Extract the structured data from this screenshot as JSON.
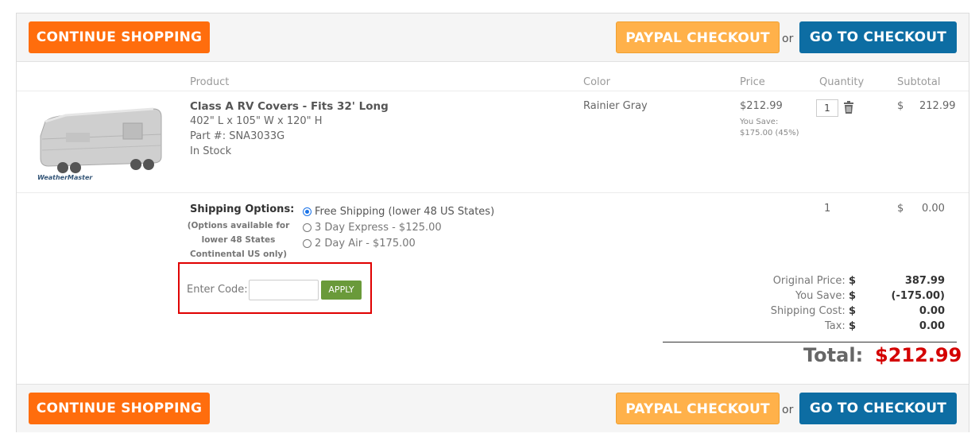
{
  "toolbar": {
    "continue_label": "CONTINUE SHOPPING",
    "paypal_label": "PAYPAL CHECKOUT",
    "or_label": "or",
    "checkout_label": "GO TO CHECKOUT"
  },
  "table": {
    "headers": {
      "product": "Product",
      "color": "Color",
      "price": "Price",
      "quantity": "Quantity",
      "subtotal": "Subtotal"
    }
  },
  "item": {
    "name": "Class A RV Covers - Fits 32' Long",
    "dimensions": "402\" L x 105\" W x 120\" H",
    "part": "Part #: SNA3033G",
    "stock": "In Stock",
    "color": "Rainier Gray",
    "price": "$212.99",
    "save_line1": "You Save:",
    "save_line2": "$175.00 (45%)",
    "quantity": "1",
    "subtotal_currency": "$",
    "subtotal": "212.99",
    "image_brand": "WeatherMaster"
  },
  "shipping": {
    "title": "Shipping Options:",
    "note": "(Options available for lower 48 States Continental US only)",
    "options": [
      {
        "label": "Free Shipping (lower 48 US States)",
        "selected": true
      },
      {
        "label": "3 Day Express - $125.00",
        "selected": false
      },
      {
        "label": "2 Day Air - $175.00",
        "selected": false
      }
    ],
    "quantity": "1",
    "subtotal_currency": "$",
    "subtotal": "0.00"
  },
  "promo": {
    "label": "Enter Code:",
    "value": "",
    "apply_label": "APPLY",
    "highlight_color": "#e00000"
  },
  "summary": {
    "original_label": "Original Price:",
    "original_value": "387.99",
    "save_label": "You Save:",
    "save_value": "(-175.00)",
    "shipping_label": "Shipping Cost:",
    "shipping_value": "0.00",
    "tax_label": "Tax:",
    "tax_value": "0.00",
    "currency": "$",
    "total_label": "Total:",
    "total_value": "$212.99"
  },
  "colors": {
    "continue": "#ff6d0d",
    "paypal": "#ffb14a",
    "checkout": "#0d6da3",
    "apply": "#6a9a3a",
    "total": "#d40000"
  }
}
